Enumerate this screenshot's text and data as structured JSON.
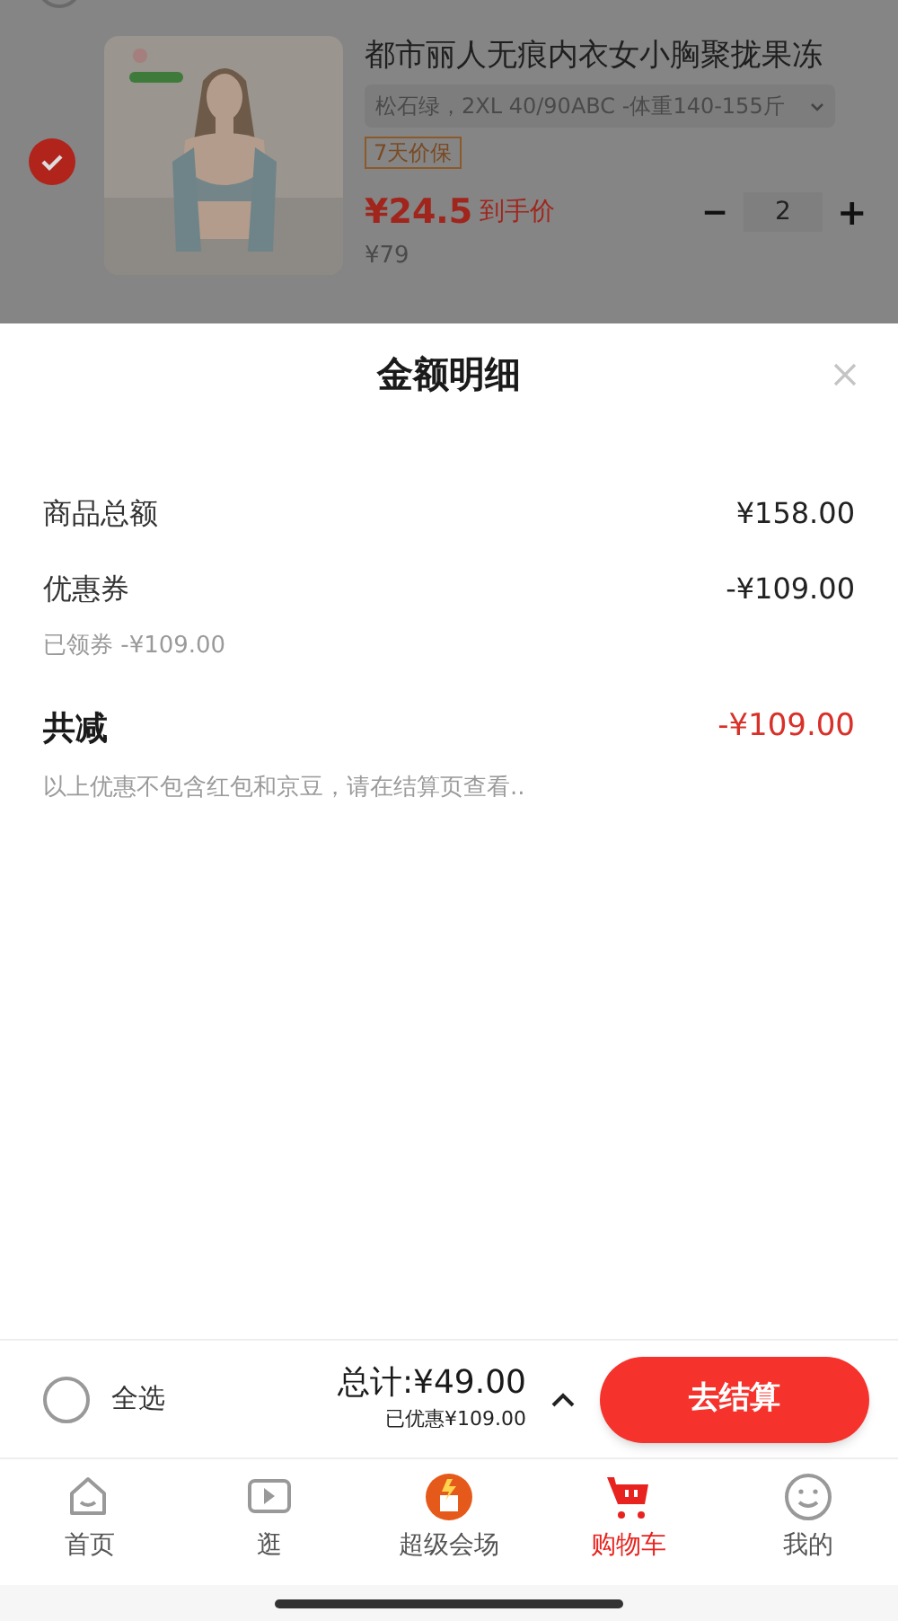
{
  "product": {
    "checked": true,
    "title": "都市丽人无痕内衣女小胸聚拢果冻",
    "variant": "松石绿，2XL 40/90ABC -体重140-155斤",
    "tag": "7天价保",
    "price": "¥24.5",
    "price_note": "到手价",
    "original_price": "¥79",
    "quantity": "2",
    "minus": "−",
    "plus": "+"
  },
  "sheet": {
    "title": "金额明细",
    "rows": [
      {
        "kind": "line",
        "label": "商品总额",
        "value": "¥158.00"
      },
      {
        "kind": "line",
        "label": "优惠券",
        "value": "-¥109.00",
        "note": "已领券 -¥109.00"
      },
      {
        "kind": "total",
        "label": "共减",
        "value": "-¥109.00",
        "note": "以上优惠不包含红包和京豆，请在结算页查看.."
      }
    ]
  },
  "checkout": {
    "select_all": {
      "label": "全选",
      "checked": false
    },
    "total": "总计:¥49.00",
    "saved": "已优惠¥109.00",
    "button": "去结算"
  },
  "tabs": [
    {
      "kind": "home",
      "label": "首页",
      "selected": false
    },
    {
      "kind": "video",
      "label": "逛",
      "selected": false
    },
    {
      "kind": "promo",
      "label": "超级会场",
      "selected": false
    },
    {
      "kind": "cart",
      "label": "购物车",
      "selected": true
    },
    {
      "kind": "me",
      "label": "我的",
      "selected": false
    }
  ]
}
